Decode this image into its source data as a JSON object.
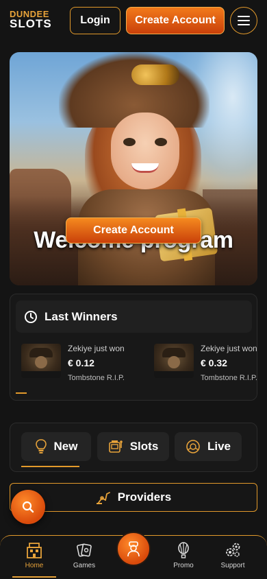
{
  "header": {
    "logo_top": "DUNDEE",
    "logo_bottom": "SLOTS",
    "login_label": "Login",
    "create_account_label": "Create Account",
    "menu_icon": "hamburger-icon"
  },
  "hero": {
    "title": "Welcome program",
    "cta_label": "Create Account"
  },
  "last_winners": {
    "title": "Last Winners",
    "icon": "clock-icon",
    "items": [
      {
        "who": "Zekiye just won",
        "amount": "€ 0.12",
        "game": "Tombstone R.I.P."
      },
      {
        "who": "Zekiye just won",
        "amount": "€ 0.32",
        "game": "Tombstone R.I.P."
      }
    ]
  },
  "categories": {
    "tabs": [
      {
        "label": "New",
        "icon": "lightbulb-icon",
        "active": true
      },
      {
        "label": "Slots",
        "icon": "slot-machine-icon",
        "active": false
      },
      {
        "label": "Live",
        "icon": "live-casino-icon",
        "active": false
      }
    ]
  },
  "providers": {
    "label": "Providers",
    "icon": "crane-icon"
  },
  "bottom_nav": {
    "items": [
      {
        "label": "Home",
        "icon": "home-icon",
        "active": true
      },
      {
        "label": "Games",
        "icon": "games-icon"
      },
      {
        "label": "",
        "icon": "avatar-icon"
      },
      {
        "label": "Promo",
        "icon": "balloon-icon"
      },
      {
        "label": "Support",
        "icon": "gears-icon"
      }
    ]
  },
  "colors": {
    "accent": "#e39a2b",
    "brand_orange": "#f27a1a",
    "background": "#141414"
  }
}
